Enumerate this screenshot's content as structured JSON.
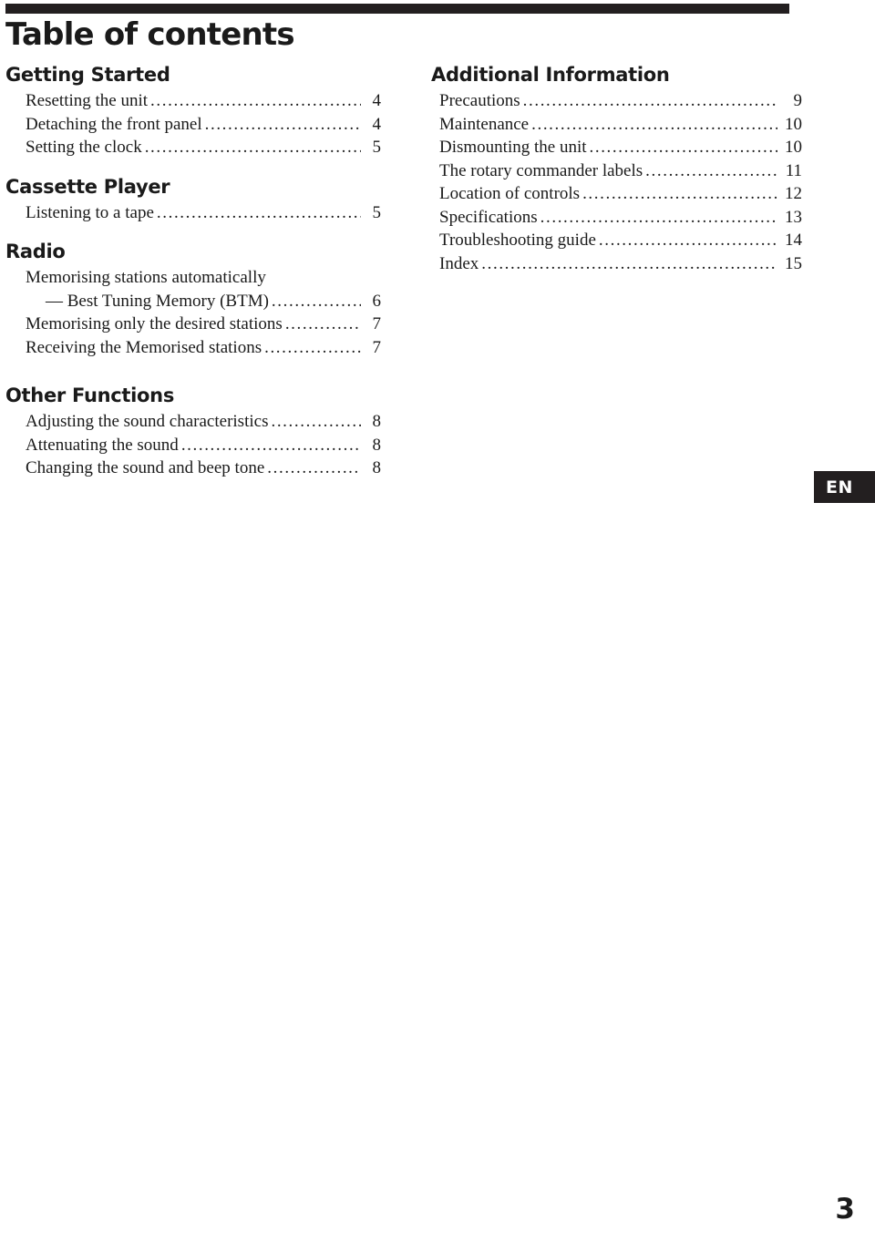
{
  "page": {
    "title": "Table of contents",
    "folio": "3",
    "language_badge": "EN",
    "rule_color": "#231f20",
    "text_color": "#1a1a1a"
  },
  "columns": {
    "left": [
      {
        "heading": "Getting Started",
        "entries": [
          {
            "label": "Resetting the unit",
            "page": "4"
          },
          {
            "label": "Detaching the front panel",
            "page": "4"
          },
          {
            "label": "Setting the clock",
            "page": "5"
          }
        ]
      },
      {
        "heading": "Cassette Player",
        "entries": [
          {
            "label": "Listening to a tape",
            "page": "5"
          }
        ]
      },
      {
        "heading": "Radio",
        "entries": [
          {
            "label": "Memorising stations automatically",
            "label_line2": "— Best Tuning Memory (BTM)",
            "page": "6"
          },
          {
            "label": "Memorising only the desired stations",
            "page": "7"
          },
          {
            "label": "Receiving the Memorised stations",
            "page": "7"
          }
        ]
      },
      {
        "heading": "Other Functions",
        "entries": [
          {
            "label": "Adjusting the sound characteristics",
            "page": "8"
          },
          {
            "label": "Attenuating the sound",
            "page": "8"
          },
          {
            "label": "Changing the sound and beep tone",
            "page": "8"
          }
        ]
      }
    ],
    "right": [
      {
        "heading": "Additional Information",
        "entries": [
          {
            "label": "Precautions",
            "page": "9"
          },
          {
            "label": "Maintenance",
            "page": "10"
          },
          {
            "label": "Dismounting the unit",
            "page": "10"
          },
          {
            "label": "The rotary commander labels",
            "page": "11"
          },
          {
            "label": "Location of controls",
            "page": "12"
          },
          {
            "label": "Specifications",
            "page": "13"
          },
          {
            "label": "Troubleshooting guide",
            "page": "14"
          },
          {
            "label": "Index",
            "page": "15"
          }
        ]
      }
    ]
  },
  "leader": {
    "dots": "......................................................................................................"
  }
}
